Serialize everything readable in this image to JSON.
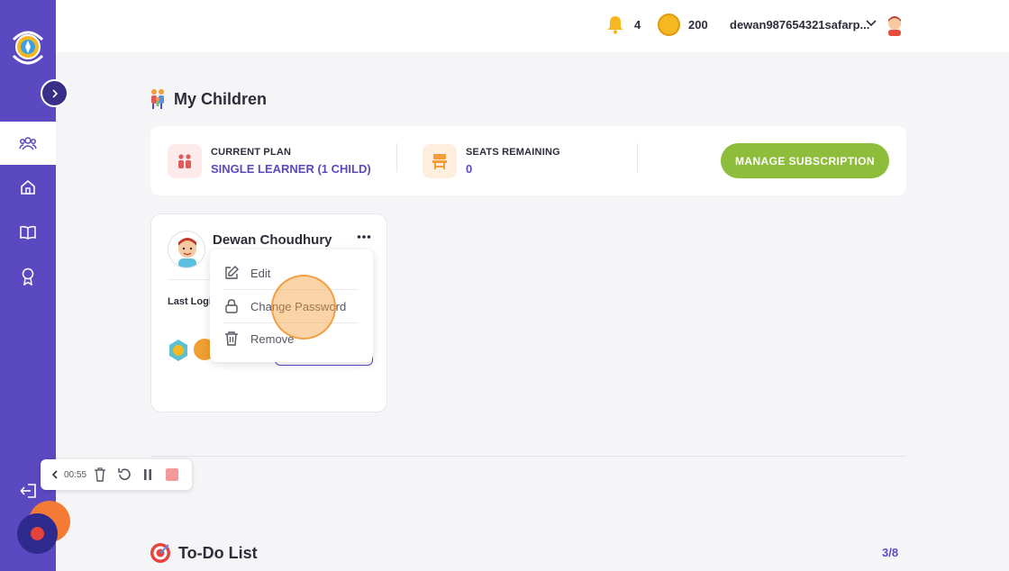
{
  "topbar": {
    "notifications_count": "4",
    "coins": "200",
    "username": "dewan987654321safarp..."
  },
  "page": {
    "title": "My Children"
  },
  "plan": {
    "current_plan_label": "CURRENT PLAN",
    "current_plan_value": "SINGLE LEARNER (1 CHILD)",
    "seats_label": "SEATS REMAINING",
    "seats_value": "0",
    "manage_button": "MANAGE SUBSCRIPTION"
  },
  "child": {
    "name": "Dewan Choudhury",
    "last_login_label": "Last Login"
  },
  "menu": {
    "items": [
      {
        "label": "Edit",
        "icon": "edit-icon"
      },
      {
        "label": "Change Password",
        "icon": "lock-icon"
      },
      {
        "label": "Remove",
        "icon": "trash-icon"
      }
    ]
  },
  "recorder": {
    "time": "00:55"
  },
  "todo": {
    "title": "To-Do List",
    "count": "3/8"
  },
  "colors": {
    "brand": "#5b49c2",
    "accent_green": "#8dbd3a",
    "orange": "#f37b35"
  }
}
